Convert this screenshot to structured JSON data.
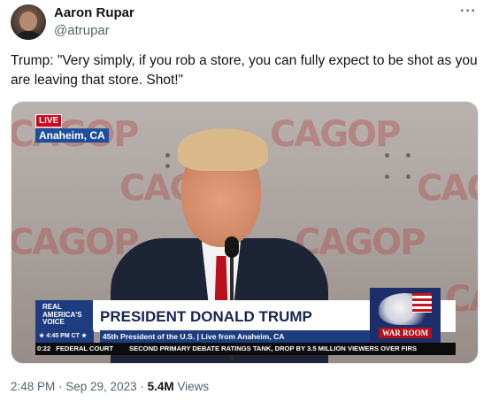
{
  "author": {
    "name": "Aaron Rupar",
    "handle": "@atrupar"
  },
  "more_menu": "···",
  "tweet_text": "Trump: \"Very simply, if you rob a store, you can fully expect to be shot as you are leaving that store. Shot!\"",
  "video": {
    "live_badge": "LIVE",
    "location": "Anaheim, CA",
    "watermark": "CAGOP",
    "network_logo": [
      "REAL",
      "AMERICA'S",
      "VOICE"
    ],
    "broadcast_time": "★ 4:45 PM CT ★",
    "lower_third_title": "PRESIDENT DONALD TRUMP",
    "lower_third_subtitle": "45th President of the U.S. | Live from Anaheim, CA",
    "show_logo": "WAR ROOM",
    "elapsed": "0:22",
    "ticker_source": "FEDERAL COURT",
    "ticker_text": "SECOND PRIMARY DEBATE RATINGS TANK, DROP BY 3.5 MILLION VIEWERS OVER FIRS"
  },
  "meta": {
    "timestamp": "2:48 PM · Sep 29, 2023 · ",
    "views_count": "5.4M",
    "views_label": " Views"
  }
}
